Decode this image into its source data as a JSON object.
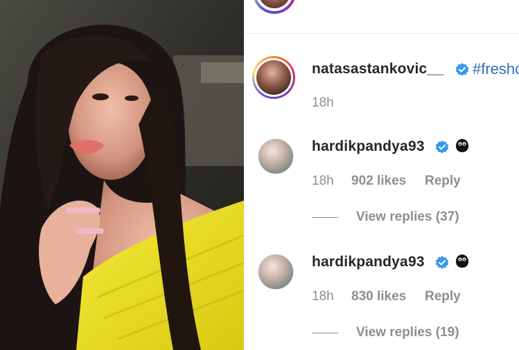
{
  "post": {
    "top_avatar_name": "natasastankovic__"
  },
  "caption": {
    "username": "natasastankovic__",
    "text": "#fresho",
    "time": "18h"
  },
  "comments": [
    {
      "username": "hardikpandya93",
      "time": "18h",
      "likes": "902 likes",
      "reply_label": "Reply",
      "view_replies": "View replies (37)"
    },
    {
      "username": "hardikpandya93",
      "time": "18h",
      "likes": "830 likes",
      "reply_label": "Reply",
      "view_replies": "View replies (19)"
    }
  ],
  "icons": {
    "verified": "verified-badge-icon",
    "emoji": "dark-face-emoji-icon"
  },
  "colors": {
    "username": "#262626",
    "meta": "#8e8e8e",
    "hashtag": "#2a6ebb",
    "verified": "#3897f0"
  }
}
